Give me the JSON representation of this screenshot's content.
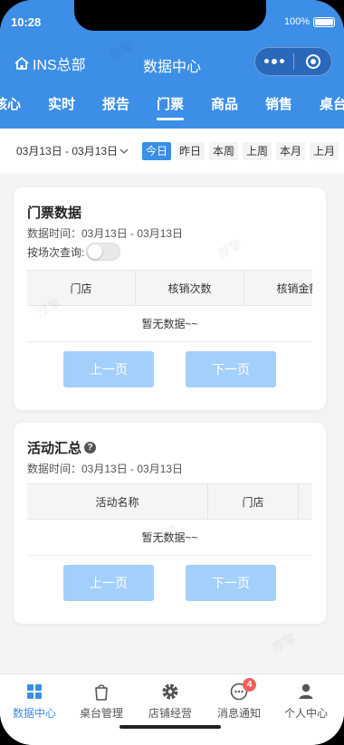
{
  "status": {
    "time": "10:28",
    "battery": "100%"
  },
  "header": {
    "store": "INS总部",
    "title": "数据中心"
  },
  "tabs": [
    {
      "label": "核心"
    },
    {
      "label": "实时"
    },
    {
      "label": "报告"
    },
    {
      "label": "门票",
      "active": true
    },
    {
      "label": "商品"
    },
    {
      "label": "销售"
    },
    {
      "label": "桌台"
    }
  ],
  "filter": {
    "range": "03月13日 - 03月13日",
    "chips": [
      {
        "label": "今日",
        "active": true
      },
      {
        "label": "昨日"
      },
      {
        "label": "本周"
      },
      {
        "label": "上周"
      },
      {
        "label": "本月"
      },
      {
        "label": "上月"
      }
    ]
  },
  "ticket_card": {
    "title": "门票数据",
    "time": "数据时间：03月13日 - 03月13日",
    "toggle_label": "按场次查询:",
    "columns": [
      "门店",
      "核销次数",
      "核销金额"
    ],
    "empty": "暂无数据~~",
    "prev": "上一页",
    "next": "下一页"
  },
  "activity_card": {
    "title": "活动汇总",
    "time": "数据时间：03月13日 - 03月13日",
    "columns": [
      "活动名称",
      "门店"
    ],
    "empty": "暂无数据~~",
    "prev": "上一页",
    "next": "下一页"
  },
  "watermark": "厚擎",
  "tabbar": [
    {
      "label": "数据中心",
      "icon": "grid-icon",
      "active": true
    },
    {
      "label": "桌台管理",
      "icon": "bag-icon"
    },
    {
      "label": "店铺经营",
      "icon": "gear-icon"
    },
    {
      "label": "消息通知",
      "icon": "chat-icon",
      "badge": "4"
    },
    {
      "label": "个人中心",
      "icon": "person-icon"
    }
  ],
  "colors": {
    "primary": "#3c8ee6",
    "button_disabled": "#a3cffb",
    "badge": "#f25d5d"
  }
}
